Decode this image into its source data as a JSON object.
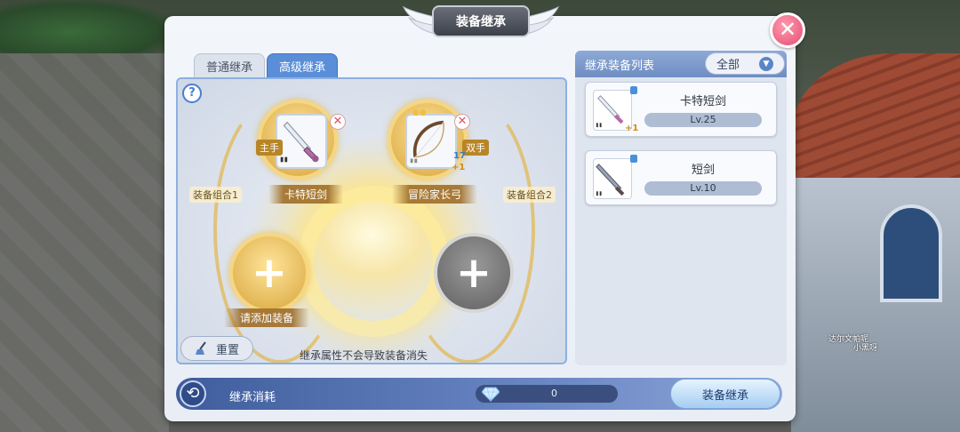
{
  "window": {
    "title": "装备继承",
    "close": "✕"
  },
  "tabs": [
    {
      "label": "普通继承",
      "active": false
    },
    {
      "label": "高级继承",
      "active": true
    }
  ],
  "help_icon": "?",
  "slots": {
    "combo1_label": "装备组合1",
    "combo2_label": "装备组合2",
    "main": {
      "hand_tag": "主手",
      "item_name": "卡特短剑",
      "remove": "✕"
    },
    "secondary": {
      "hand_tag": "双手",
      "item_name": "冒险家长弓",
      "level": "17",
      "plus": "+1",
      "remove": "✕"
    },
    "add_slot_1": {
      "plus": "+",
      "label": "请添加装备"
    },
    "add_slot_2": {
      "plus": "+"
    }
  },
  "reset_label": "重置",
  "hint": "继承属性不会导致装备消失",
  "list": {
    "title": "继承装备列表",
    "filter": "全部",
    "items": [
      {
        "name": "卡特短剑",
        "level": "Lv.25",
        "plus": "+1"
      },
      {
        "name": "短剑",
        "level": "Lv.10"
      }
    ]
  },
  "bottom": {
    "cost_label": "继承消耗",
    "cost_value": "0",
    "confirm_label": "装备继承"
  },
  "scene": {
    "npc_names": [
      "达尔文帕呢",
      "小黑呀"
    ]
  },
  "colors": {
    "tab_active": "#5a8ed8",
    "close_button": "#e44d73",
    "gold_slot": "#d7a53c",
    "bottom_bar": "#3f5d9c"
  }
}
